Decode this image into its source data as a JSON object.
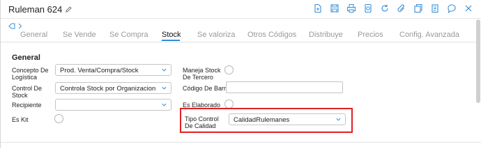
{
  "window": {
    "title": "Ruleman 624"
  },
  "toolbar": {
    "icons": [
      "new-document-icon",
      "save-icon",
      "print-icon",
      "history-icon",
      "refresh-icon",
      "attach-icon",
      "duplicate-icon",
      "notes-icon",
      "comment-icon",
      "close-icon"
    ],
    "accent": "#3a8fd6"
  },
  "tabs": [
    {
      "label": "General",
      "active": false
    },
    {
      "label": "Se Vende",
      "active": false
    },
    {
      "label": "Se Compra",
      "active": false
    },
    {
      "label": "Stock",
      "active": true
    },
    {
      "label": "Se valoriza",
      "active": false
    },
    {
      "label": "Otros Códigos",
      "active": false
    },
    {
      "label": "Distribuye",
      "active": false
    },
    {
      "label": "Precios",
      "active": false
    },
    {
      "label": "Config. Avanzada",
      "active": false
    }
  ],
  "section": {
    "title": "General"
  },
  "form": {
    "concepto": {
      "label": "Concepto De Logística",
      "value": "Prod. Venta/Compra/Stock"
    },
    "control": {
      "label": "Control De Stock",
      "value": "Controla Stock por Organizacion"
    },
    "recipiente": {
      "label": "Recipiente",
      "value": ""
    },
    "eskit": {
      "label": "Es Kit",
      "checked": false
    },
    "maneja": {
      "label": "Maneja Stock De Tercero",
      "checked": false
    },
    "codigo": {
      "label": "Código De Barra",
      "value": ""
    },
    "elaborado": {
      "label": "Es Elaborado",
      "checked": false
    },
    "tipo": {
      "label": "Tipo Control De Calidad",
      "value": "CalidadRulemanes"
    }
  },
  "colors": {
    "highlight": "#e02020",
    "active_tab_underline": "#2d8dd6"
  }
}
